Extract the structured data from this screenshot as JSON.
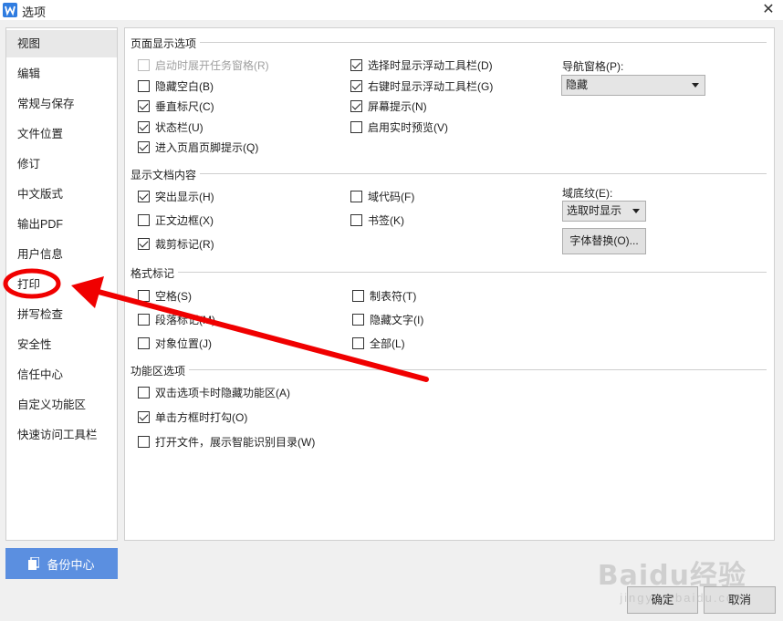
{
  "window": {
    "title": "选项",
    "close_glyph": "✕"
  },
  "sidebar": {
    "items": [
      {
        "label": "视图",
        "active": true
      },
      {
        "label": "编辑"
      },
      {
        "label": "常规与保存"
      },
      {
        "label": "文件位置"
      },
      {
        "label": "修订"
      },
      {
        "label": "中文版式"
      },
      {
        "label": "输出PDF"
      },
      {
        "label": "用户信息"
      },
      {
        "label": "打印"
      },
      {
        "label": "拼写检查"
      },
      {
        "label": "安全性"
      },
      {
        "label": "信任中心"
      },
      {
        "label": "自定义功能区"
      },
      {
        "label": "快速访问工具栏"
      }
    ],
    "backup_label": "备份中心"
  },
  "sections": {
    "page_display": {
      "title": "页面显示选项",
      "options": [
        {
          "label": "启动时展开任务窗格(R)",
          "checked": false,
          "disabled": true
        },
        {
          "label": "隐藏空白(B)",
          "checked": false
        },
        {
          "label": "垂直标尺(C)",
          "checked": true
        },
        {
          "label": "状态栏(U)",
          "checked": true
        },
        {
          "label": "进入页眉页脚提示(Q)",
          "checked": true
        },
        {
          "label": "选择时显示浮动工具栏(D)",
          "checked": true
        },
        {
          "label": "右键时显示浮动工具栏(G)",
          "checked": true
        },
        {
          "label": "屏幕提示(N)",
          "checked": true
        },
        {
          "label": "启用实时预览(V)",
          "checked": false
        }
      ],
      "nav_pane_label": "导航窗格(P):",
      "nav_pane_value": "隐藏"
    },
    "doc_content": {
      "title": "显示文档内容",
      "options": [
        {
          "label": "突出显示(H)",
          "checked": true
        },
        {
          "label": "正文边框(X)",
          "checked": false
        },
        {
          "label": "裁剪标记(R)",
          "checked": true
        },
        {
          "label": "域代码(F)",
          "checked": false
        },
        {
          "label": "书签(K)",
          "checked": false
        }
      ],
      "field_shading_label": "域底纹(E):",
      "field_shading_value": "选取时显示",
      "font_sub_button": "字体替换(O)..."
    },
    "format_marks": {
      "title": "格式标记",
      "options": [
        {
          "label": "空格(S)",
          "checked": false
        },
        {
          "label": "段落标记(M)",
          "checked": false
        },
        {
          "label": "对象位置(J)",
          "checked": false
        },
        {
          "label": "制表符(T)",
          "checked": false
        },
        {
          "label": "隐藏文字(I)",
          "checked": false
        },
        {
          "label": "全部(L)",
          "checked": false
        }
      ]
    },
    "ribbon": {
      "title": "功能区选项",
      "options": [
        {
          "label": "双击选项卡时隐藏功能区(A)",
          "checked": false
        },
        {
          "label": "单击方框时打勾(O)",
          "checked": true
        },
        {
          "label": "打开文件，展示智能识别目录(W)",
          "checked": false
        }
      ]
    }
  },
  "footer": {
    "ok_label": "确定",
    "cancel_label": "取消"
  },
  "watermark": {
    "main": "Baidu经验",
    "sub": "jingyan.baidu.com"
  },
  "colors": {
    "annotation_red": "#f00000",
    "backup_blue": "#5b8fe0",
    "app_icon_blue": "#2f7ce0"
  }
}
